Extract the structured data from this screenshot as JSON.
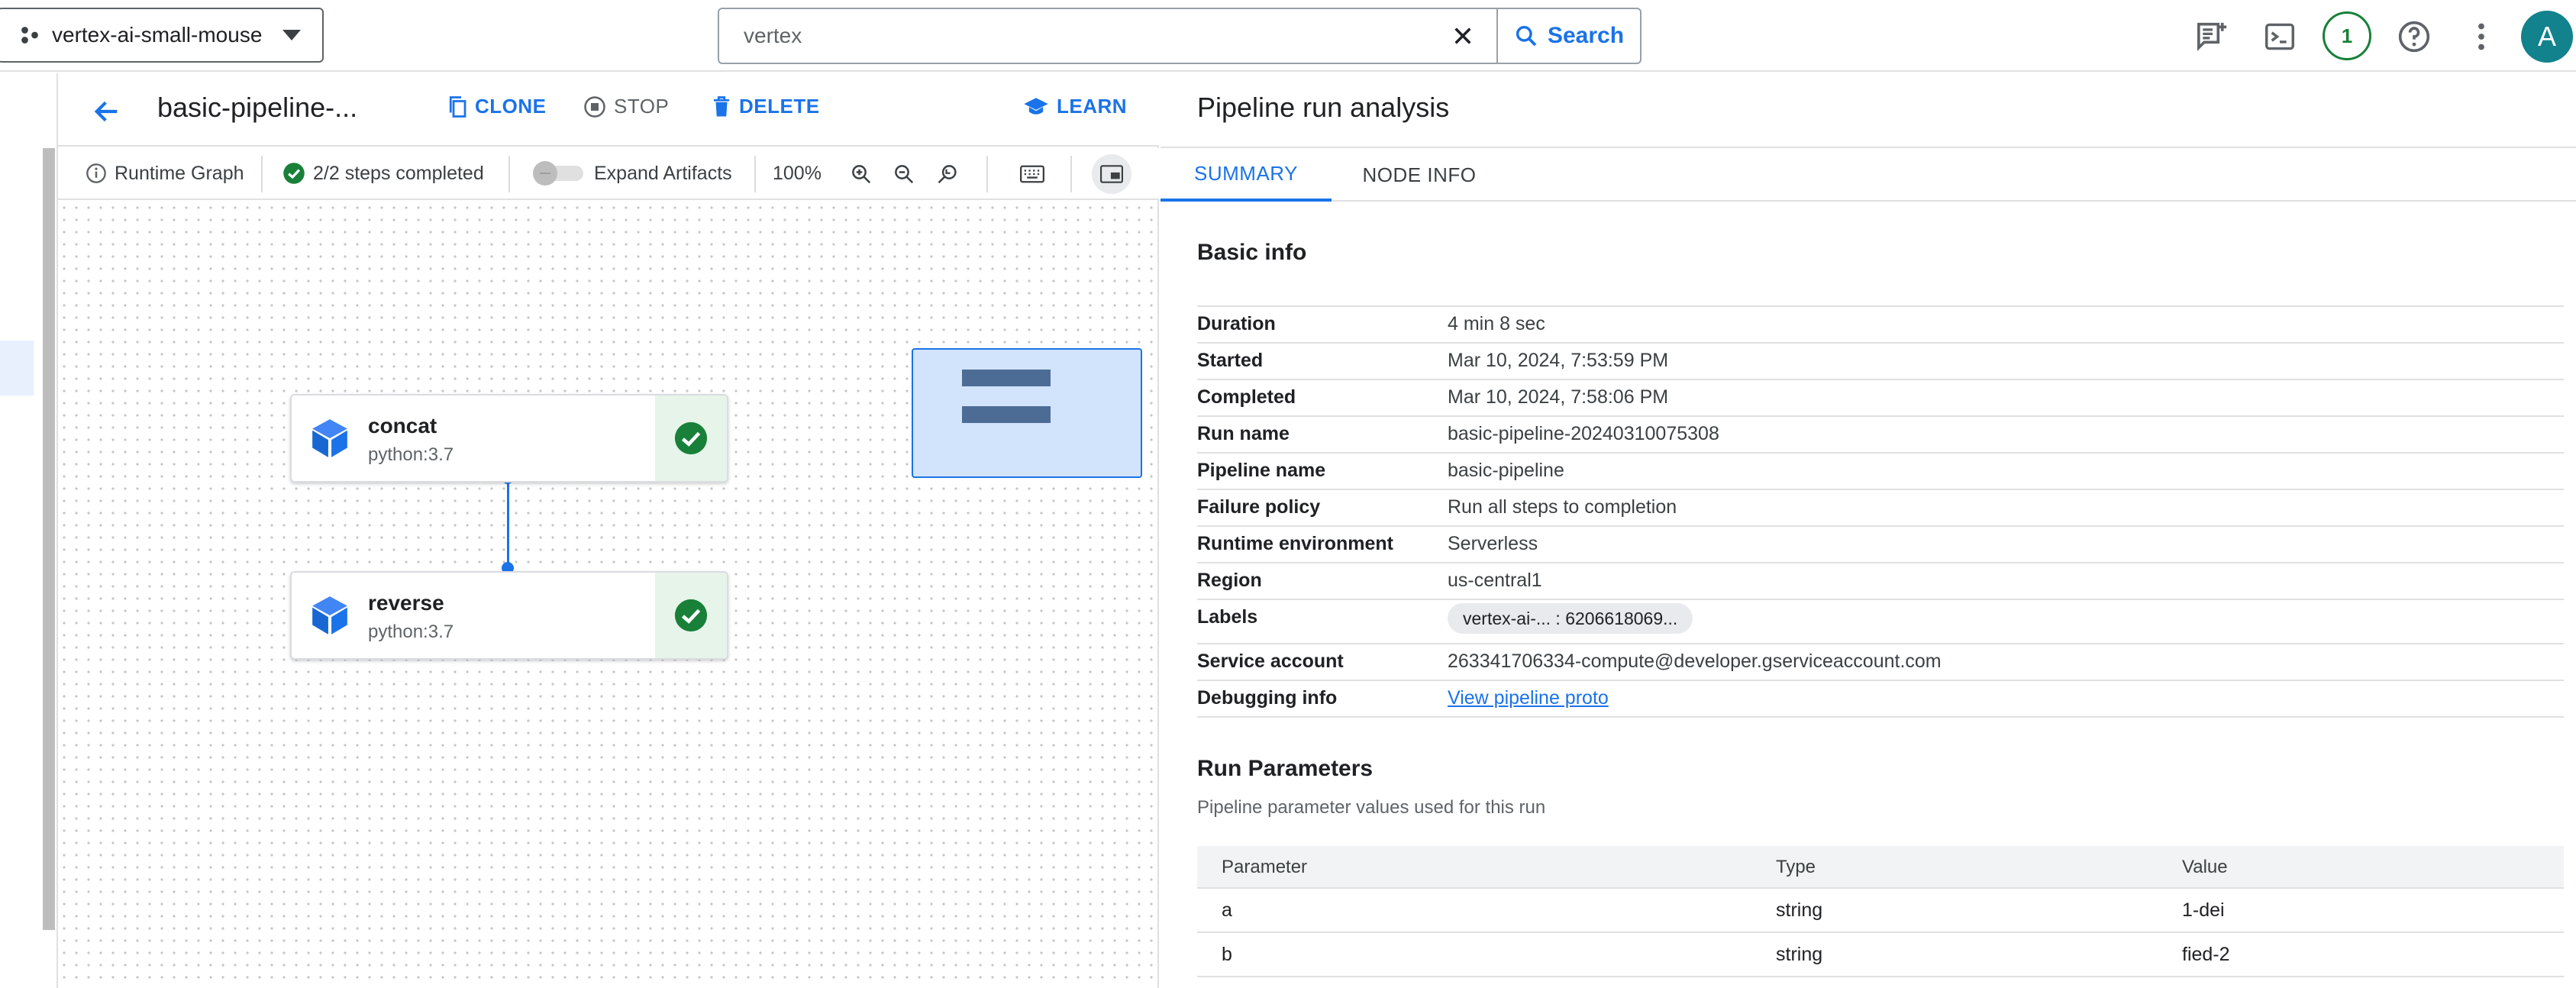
{
  "topbar": {
    "project": "vertex-ai-small-mouse",
    "search_value": "vertex",
    "search_button": "Search",
    "notification_count": "1",
    "avatar_letter": "A"
  },
  "pipeline": {
    "title": "basic-pipeline-...",
    "actions": {
      "clone": "CLONE",
      "stop": "STOP",
      "delete": "DELETE",
      "learn": "LEARN"
    }
  },
  "toolbar": {
    "runtime_graph": "Runtime Graph",
    "steps_completed": "2/2 steps completed",
    "expand_artifacts": "Expand Artifacts",
    "zoom": "100%"
  },
  "graph": {
    "nodes": [
      {
        "name": "concat",
        "image": "python:3.7",
        "status": "succeeded"
      },
      {
        "name": "reverse",
        "image": "python:3.7",
        "status": "succeeded"
      }
    ]
  },
  "analysis": {
    "title": "Pipeline run analysis",
    "tabs": [
      "SUMMARY",
      "NODE INFO"
    ],
    "active_tab": "SUMMARY",
    "basic_info_title": "Basic info",
    "basic_info": [
      {
        "key": "Duration",
        "value": "4 min 8 sec"
      },
      {
        "key": "Started",
        "value": "Mar 10, 2024, 7:53:59 PM"
      },
      {
        "key": "Completed",
        "value": "Mar 10, 2024, 7:58:06 PM"
      },
      {
        "key": "Run name",
        "value": "basic-pipeline-20240310075308"
      },
      {
        "key": "Pipeline name",
        "value": "basic-pipeline"
      },
      {
        "key": "Failure policy",
        "value": "Run all steps to completion"
      },
      {
        "key": "Runtime environment",
        "value": "Serverless"
      },
      {
        "key": "Region",
        "value": "us-central1"
      },
      {
        "key": "Labels",
        "value": "vertex-ai-... : 6206618069..."
      },
      {
        "key": "Service account",
        "value": "263341706334-compute@developer.gserviceaccount.com"
      },
      {
        "key": "Debugging info",
        "value": "View pipeline proto"
      }
    ],
    "run_params_title": "Run Parameters",
    "run_params_desc": "Pipeline parameter values used for this run",
    "params_headers": [
      "Parameter",
      "Type",
      "Value"
    ],
    "params": [
      {
        "name": "a",
        "type": "string",
        "value": "1-dei"
      },
      {
        "name": "b",
        "type": "string",
        "value": "fied-2"
      }
    ]
  },
  "colors": {
    "accent": "#1a73e8",
    "success": "#188038",
    "minimap": "#d2e3fc",
    "avatar": "#12828c"
  }
}
